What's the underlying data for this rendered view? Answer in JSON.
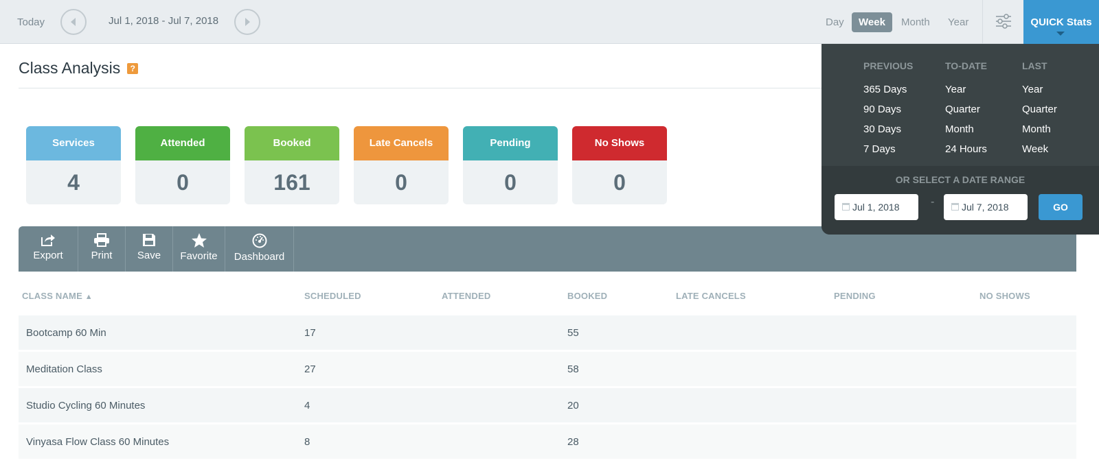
{
  "topbar": {
    "today_label": "Today",
    "date_range": "Jul 1, 2018 - Jul 7, 2018",
    "periods": [
      "Day",
      "Week",
      "Month",
      "Year"
    ],
    "active_period": "Week",
    "quick_stats_label": "QUICK Stats"
  },
  "page": {
    "title": "Class Analysis",
    "help_badge": "?"
  },
  "stats": [
    {
      "label": "Services",
      "value": "4",
      "color": "#6cb8df"
    },
    {
      "label": "Attended",
      "value": "0",
      "color": "#4fb043"
    },
    {
      "label": "Booked",
      "value": "161",
      "color": "#7bc24f"
    },
    {
      "label": "Late Cancels",
      "value": "0",
      "color": "#ee963d"
    },
    {
      "label": "Pending",
      "value": "0",
      "color": "#42b0b4"
    },
    {
      "label": "No Shows",
      "value": "0",
      "color": "#cf2a2f"
    }
  ],
  "toolbar": {
    "export": "Export",
    "print": "Print",
    "save": "Save",
    "favorite": "Favorite",
    "dashboard": "Dashboard"
  },
  "table": {
    "columns": [
      "CLASS NAME",
      "SCHEDULED",
      "ATTENDED",
      "BOOKED",
      "LATE CANCELS",
      "PENDING",
      "NO SHOWS"
    ],
    "sort_indicator": "▲",
    "rows": [
      {
        "name": "Bootcamp 60 Min",
        "scheduled": "17",
        "booked": "55"
      },
      {
        "name": "Meditation Class",
        "scheduled": "27",
        "booked": "58"
      },
      {
        "name": "Studio Cycling 60 Minutes",
        "scheduled": "4",
        "booked": "20"
      },
      {
        "name": "Vinyasa Flow Class 60 Minutes",
        "scheduled": "8",
        "booked": "28"
      }
    ]
  },
  "quick_stats": {
    "headers": [
      "PREVIOUS",
      "TO-DATE",
      "LAST"
    ],
    "previous": [
      "365 Days",
      "90 Days",
      "30 Days",
      "7 Days"
    ],
    "to_date": [
      "Year",
      "Quarter",
      "Month",
      "24 Hours"
    ],
    "last": [
      "Year",
      "Quarter",
      "Month",
      "Week"
    ],
    "range_label": "OR SELECT A DATE RANGE",
    "start_date": "Jul 1, 2018",
    "end_date": "Jul 7, 2018",
    "separator": "-",
    "go_label": "GO"
  },
  "colors": {
    "accent": "#3a98d2",
    "toolbar": "#6f858e",
    "dropdown": "#3b4446"
  }
}
